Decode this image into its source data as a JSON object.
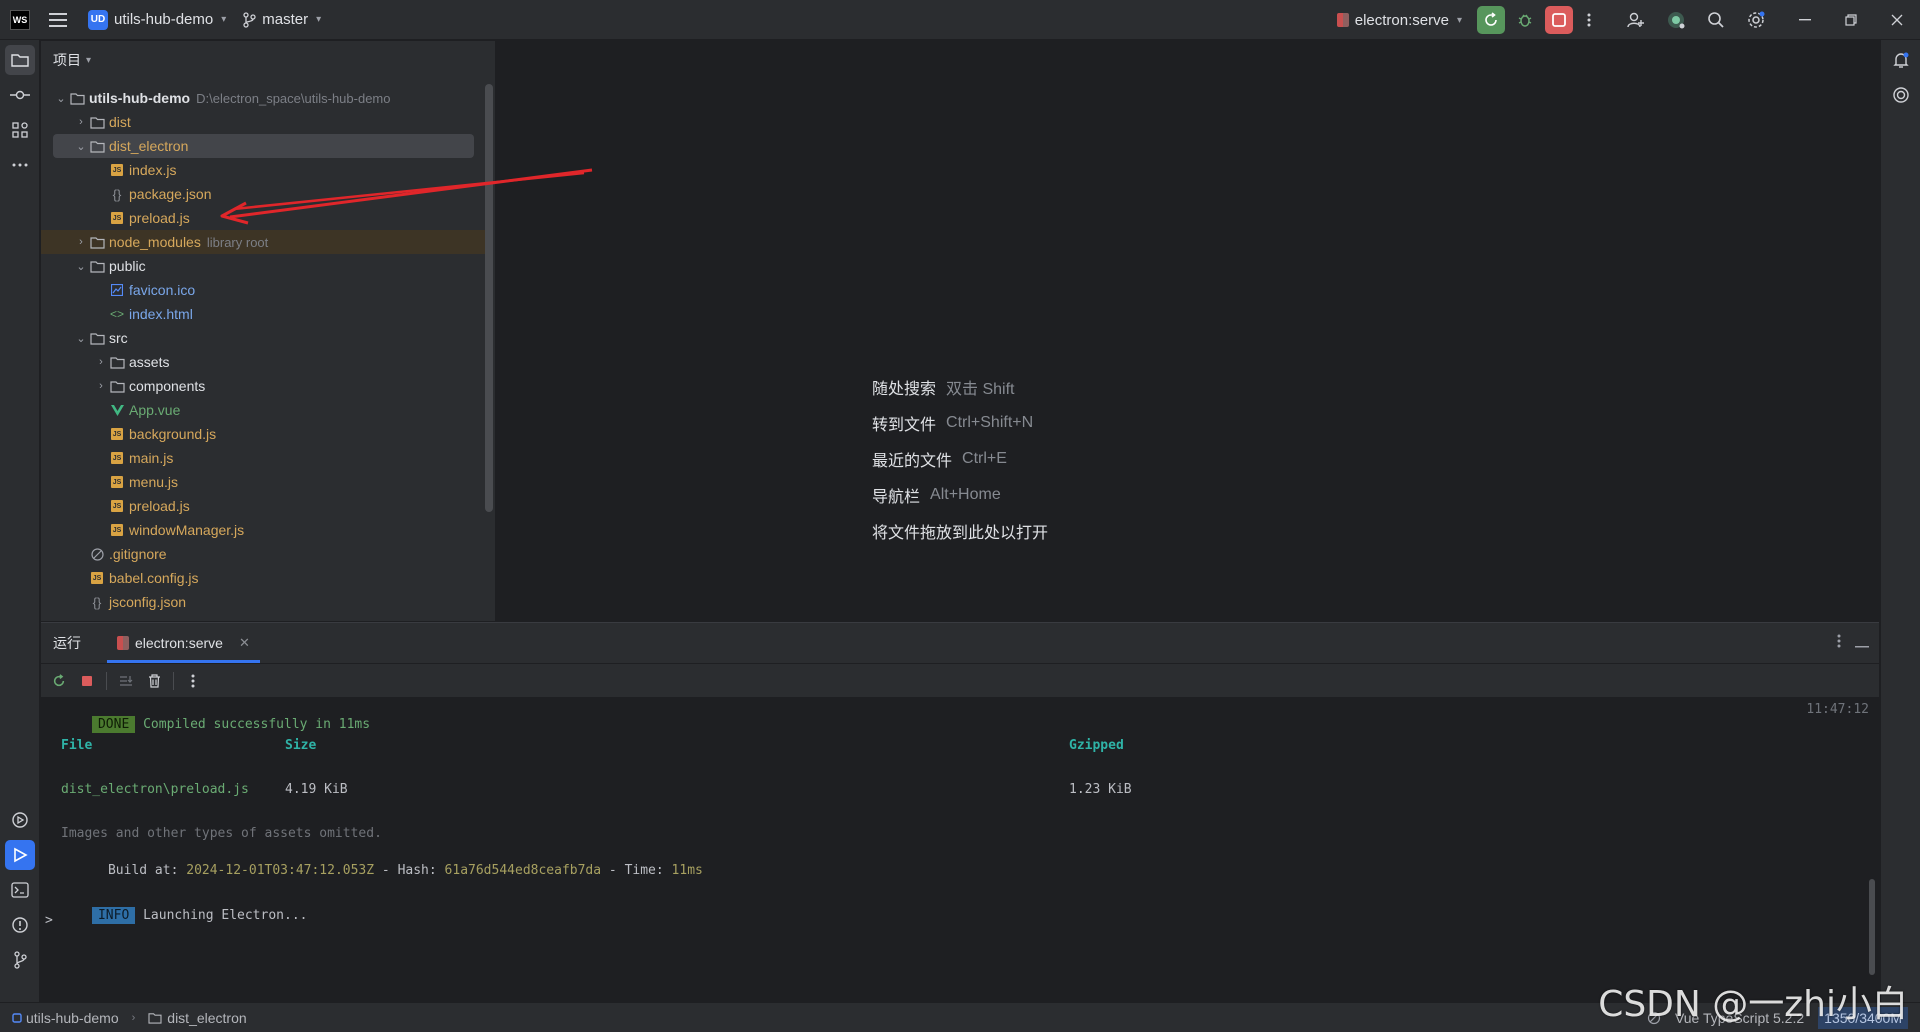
{
  "titlebar": {
    "logo": "WS",
    "project_badge": "UD",
    "project_name": "utils-hub-demo",
    "branch": "master",
    "run_config": "electron:serve"
  },
  "project_panel": {
    "title": "项目",
    "root": {
      "name": "utils-hub-demo",
      "path": "D:\\electron_space\\utils-hub-demo"
    },
    "items": [
      {
        "name": "dist"
      },
      {
        "name": "dist_electron"
      },
      {
        "name": "index.js"
      },
      {
        "name": "package.json"
      },
      {
        "name": "preload.js"
      },
      {
        "name": "node_modules",
        "hint": "library root"
      },
      {
        "name": "public"
      },
      {
        "name": "favicon.ico"
      },
      {
        "name": "index.html"
      },
      {
        "name": "src"
      },
      {
        "name": "assets"
      },
      {
        "name": "components"
      },
      {
        "name": "App.vue"
      },
      {
        "name": "background.js"
      },
      {
        "name": "main.js"
      },
      {
        "name": "menu.js"
      },
      {
        "name": "preload.js"
      },
      {
        "name": "windowManager.js"
      },
      {
        "name": ".gitignore"
      },
      {
        "name": "babel.config.js"
      },
      {
        "name": "jsconfig.json"
      }
    ]
  },
  "editor_hints": [
    {
      "label": "随处搜索",
      "key": "双击 Shift"
    },
    {
      "label": "转到文件",
      "key": "Ctrl+Shift+N"
    },
    {
      "label": "最近的文件",
      "key": "Ctrl+E"
    },
    {
      "label": "导航栏",
      "key": "Alt+Home"
    },
    {
      "label": "将文件拖放到此处以打开",
      "key": ""
    }
  ],
  "run_panel": {
    "title": "运行",
    "tab": "electron:serve",
    "console": {
      "done_tag": "DONE",
      "done_msg": "Compiled successfully in 11ms",
      "timestamp": "11:47:12",
      "col_file": "File",
      "col_size": "Size",
      "col_gzipped": "Gzipped",
      "row_file": "dist_electron\\preload.js",
      "row_size": "4.19 KiB",
      "row_gzipped": "1.23 KiB",
      "omitted": "Images and other types of assets omitted.",
      "build_label": "Build at:",
      "build_date": "2024-12-01T03:47:12.053Z",
      "hash_label": "- Hash:",
      "hash": "61a76d544ed8ceafb7da",
      "time_label": "- Time:",
      "time": "11ms",
      "info_tag": "INFO",
      "info_msg": "Launching Electron...",
      "prompt": ">"
    }
  },
  "statusbar": {
    "crumb_project": "utils-hub-demo",
    "crumb_folder": "dist_electron",
    "language": "Vue TypeScript 5.2.2",
    "memory": "1350/3400M"
  },
  "watermark": "CSDN @一zhi小白",
  "colors": {
    "accent": "#3574f0",
    "annotation_arrow": "#e0262a",
    "run_green": "#57965c",
    "stop_red": "#db5c5c"
  }
}
